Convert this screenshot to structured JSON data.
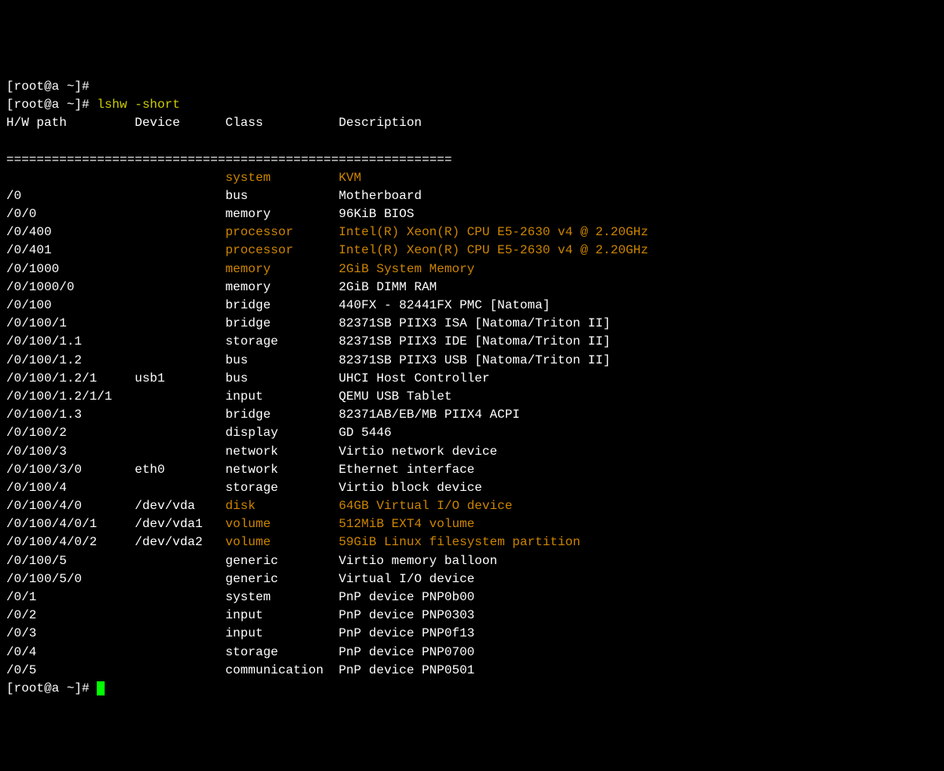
{
  "prompts": {
    "line1": "[root@a ~]#",
    "line2_prompt": "[root@a ~]# ",
    "line2_cmd": "lshw -short",
    "final_prompt": "[root@a ~]# "
  },
  "header": {
    "path": "H/W path",
    "device": "Device",
    "class": "Class",
    "description": "Description"
  },
  "separator": "===========================================================",
  "rows": [
    {
      "path": "",
      "device": "",
      "class": "system",
      "description": "KVM",
      "highlighted": true
    },
    {
      "path": "/0",
      "device": "",
      "class": "bus",
      "description": "Motherboard",
      "highlighted": false
    },
    {
      "path": "/0/0",
      "device": "",
      "class": "memory",
      "description": "96KiB BIOS",
      "highlighted": false
    },
    {
      "path": "/0/400",
      "device": "",
      "class": "processor",
      "description": "Intel(R) Xeon(R) CPU E5-2630 v4 @ 2.20GHz",
      "highlighted": true
    },
    {
      "path": "/0/401",
      "device": "",
      "class": "processor",
      "description": "Intel(R) Xeon(R) CPU E5-2630 v4 @ 2.20GHz",
      "highlighted": true
    },
    {
      "path": "/0/1000",
      "device": "",
      "class": "memory",
      "description": "2GiB System Memory",
      "highlighted": true
    },
    {
      "path": "/0/1000/0",
      "device": "",
      "class": "memory",
      "description": "2GiB DIMM RAM",
      "highlighted": false
    },
    {
      "path": "/0/100",
      "device": "",
      "class": "bridge",
      "description": "440FX - 82441FX PMC [Natoma]",
      "highlighted": false
    },
    {
      "path": "/0/100/1",
      "device": "",
      "class": "bridge",
      "description": "82371SB PIIX3 ISA [Natoma/Triton II]",
      "highlighted": false
    },
    {
      "path": "/0/100/1.1",
      "device": "",
      "class": "storage",
      "description": "82371SB PIIX3 IDE [Natoma/Triton II]",
      "highlighted": false
    },
    {
      "path": "/0/100/1.2",
      "device": "",
      "class": "bus",
      "description": "82371SB PIIX3 USB [Natoma/Triton II]",
      "highlighted": false
    },
    {
      "path": "/0/100/1.2/1",
      "device": "usb1",
      "class": "bus",
      "description": "UHCI Host Controller",
      "highlighted": false
    },
    {
      "path": "/0/100/1.2/1/1",
      "device": "",
      "class": "input",
      "description": "QEMU USB Tablet",
      "highlighted": false
    },
    {
      "path": "/0/100/1.3",
      "device": "",
      "class": "bridge",
      "description": "82371AB/EB/MB PIIX4 ACPI",
      "highlighted": false
    },
    {
      "path": "/0/100/2",
      "device": "",
      "class": "display",
      "description": "GD 5446",
      "highlighted": false
    },
    {
      "path": "/0/100/3",
      "device": "",
      "class": "network",
      "description": "Virtio network device",
      "highlighted": false
    },
    {
      "path": "/0/100/3/0",
      "device": "eth0",
      "class": "network",
      "description": "Ethernet interface",
      "highlighted": false
    },
    {
      "path": "/0/100/4",
      "device": "",
      "class": "storage",
      "description": "Virtio block device",
      "highlighted": false
    },
    {
      "path": "/0/100/4/0",
      "device": "/dev/vda",
      "class": "disk",
      "description": "64GB Virtual I/O device",
      "highlighted": true
    },
    {
      "path": "/0/100/4/0/1",
      "device": "/dev/vda1",
      "class": "volume",
      "description": "512MiB EXT4 volume",
      "highlighted": true
    },
    {
      "path": "/0/100/4/0/2",
      "device": "/dev/vda2",
      "class": "volume",
      "description": "59GiB Linux filesystem partition",
      "highlighted": true
    },
    {
      "path": "/0/100/5",
      "device": "",
      "class": "generic",
      "description": "Virtio memory balloon",
      "highlighted": false
    },
    {
      "path": "/0/100/5/0",
      "device": "",
      "class": "generic",
      "description": "Virtual I/O device",
      "highlighted": false
    },
    {
      "path": "/0/1",
      "device": "",
      "class": "system",
      "description": "PnP device PNP0b00",
      "highlighted": false
    },
    {
      "path": "/0/2",
      "device": "",
      "class": "input",
      "description": "PnP device PNP0303",
      "highlighted": false
    },
    {
      "path": "/0/3",
      "device": "",
      "class": "input",
      "description": "PnP device PNP0f13",
      "highlighted": false
    },
    {
      "path": "/0/4",
      "device": "",
      "class": "storage",
      "description": "PnP device PNP0700",
      "highlighted": false
    },
    {
      "path": "/0/5",
      "device": "",
      "class": "communication",
      "description": "PnP device PNP0501",
      "highlighted": false
    }
  ]
}
